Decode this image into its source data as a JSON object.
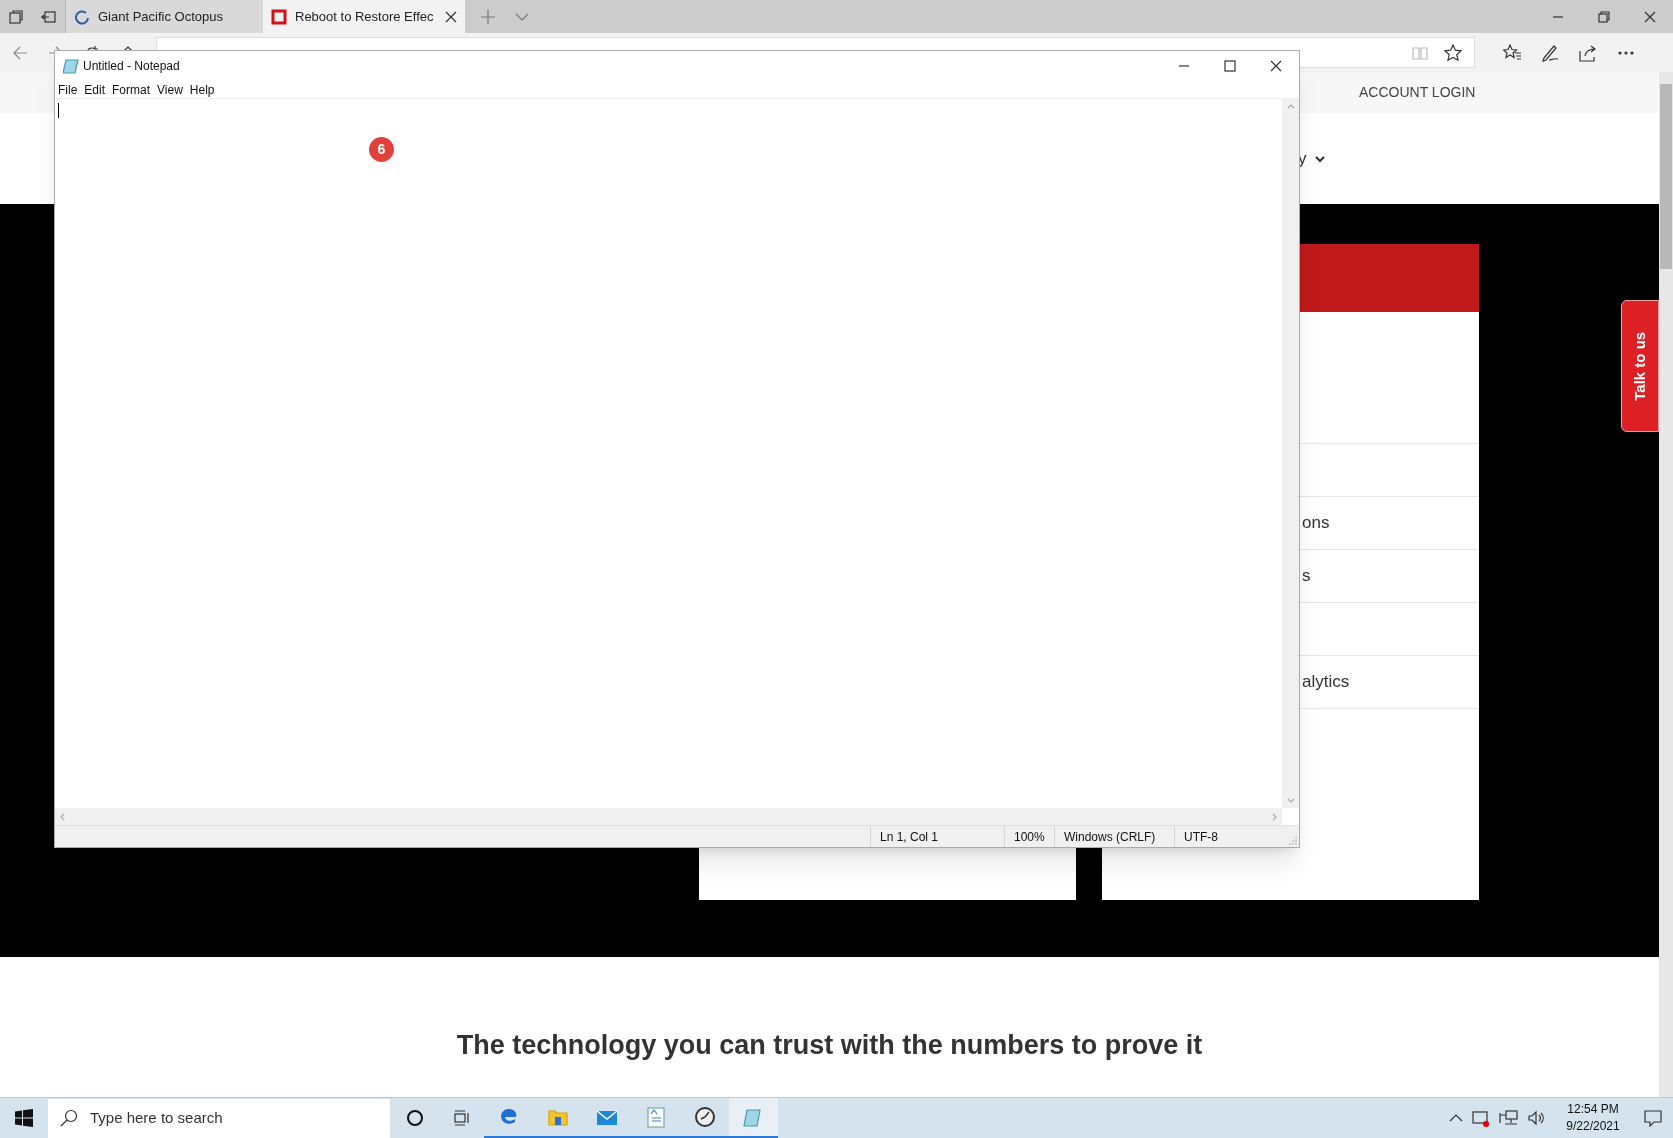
{
  "browser": {
    "tabs": [
      {
        "title": "Giant Pacific Octopus",
        "selected": false
      },
      {
        "title": "Reboot to Restore Effec",
        "selected": true
      }
    ]
  },
  "website": {
    "account_login": "ACCOUNT LOGIN",
    "nav_fragment": "y",
    "menu_rows": [
      {
        "kind": "blank"
      },
      {
        "kind": "text",
        "text": "ons"
      },
      {
        "kind": "text",
        "text": "s"
      },
      {
        "kind": "blank"
      },
      {
        "kind": "text",
        "text": "alytics"
      }
    ],
    "talk_tab": "Talk to us",
    "headline": "The technology you can trust with the numbers to prove it"
  },
  "notepad": {
    "title": "Untitled - Notepad",
    "menu": [
      "File",
      "Edit",
      "Format",
      "View",
      "Help"
    ],
    "status": [
      "Ln 1, Col 1",
      "100%",
      "Windows (CRLF)",
      "UTF-8"
    ],
    "badge": "6"
  },
  "taskbar": {
    "search_placeholder": "Type here to search",
    "apps": [
      {
        "kind": "edge",
        "selected": false
      },
      {
        "kind": "folder",
        "selected": false
      },
      {
        "kind": "mail",
        "selected": false
      },
      {
        "kind": "document",
        "selected": false
      },
      {
        "kind": "clock",
        "selected": false
      },
      {
        "kind": "notepad",
        "selected": true
      }
    ],
    "time": "12:54 PM",
    "date": "9/22/2021"
  }
}
